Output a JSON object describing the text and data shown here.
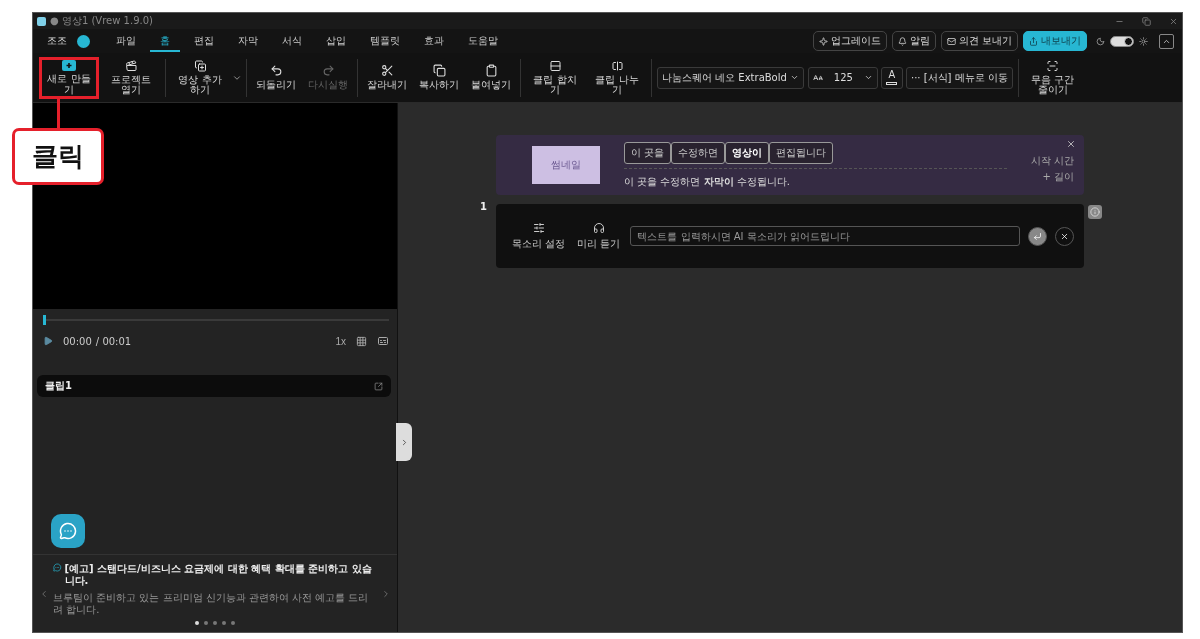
{
  "window": {
    "title": "● 영상1 (Vrew 1.9.0)"
  },
  "menu": {
    "user": "조조",
    "items": [
      {
        "label": "파일",
        "selected": false
      },
      {
        "label": "홈",
        "selected": true
      },
      {
        "label": "편집",
        "selected": false
      },
      {
        "label": "자막",
        "selected": false
      },
      {
        "label": "서식",
        "selected": false
      },
      {
        "label": "삽입",
        "selected": false
      },
      {
        "label": "템플릿",
        "selected": false
      },
      {
        "label": "효과",
        "selected": false
      },
      {
        "label": "도움말",
        "selected": false
      }
    ]
  },
  "top_actions": [
    {
      "label": "업그레이드",
      "kind": "outline"
    },
    {
      "label": "알림",
      "kind": "outline"
    },
    {
      "label": "의견 보내기",
      "kind": "outline"
    },
    {
      "label": "내보내기",
      "kind": "primary"
    }
  ],
  "theme_toggle": {
    "on": true
  },
  "toolbar": {
    "groups": [
      [
        {
          "kind": "button",
          "label": "새로 만들기",
          "disabled": false,
          "highlighted": true
        },
        {
          "kind": "button",
          "label": "프로젝트 열기",
          "disabled": false,
          "highlighted": false
        }
      ],
      [
        {
          "kind": "button",
          "label": "영상 추가하기",
          "disabled": false,
          "highlighted": false
        },
        {
          "kind": "caret"
        }
      ],
      [
        {
          "kind": "button",
          "label": "되돌리기",
          "disabled": false,
          "highlighted": false
        },
        {
          "kind": "button",
          "label": "다시실행",
          "disabled": true,
          "highlighted": false
        }
      ],
      [
        {
          "kind": "button",
          "label": "잘라내기",
          "disabled": false,
          "highlighted": false
        },
        {
          "kind": "button",
          "label": "복사하기",
          "disabled": false,
          "highlighted": false
        },
        {
          "kind": "button",
          "label": "붙여넣기",
          "disabled": false,
          "highlighted": false
        }
      ],
      [
        {
          "kind": "button",
          "label": "클립 합치기",
          "disabled": false,
          "highlighted": false
        },
        {
          "kind": "button",
          "label": "클립 나누기",
          "disabled": false,
          "highlighted": false
        }
      ],
      [
        {
          "kind": "font",
          "value": "나눔스퀘어 네오 ExtraBold"
        },
        {
          "kind": "size",
          "value": "125"
        },
        {
          "kind": "color",
          "value": "A"
        },
        {
          "kind": "link",
          "label": "··· [서식] 메뉴로 이동"
        }
      ],
      [
        {
          "kind": "button",
          "label": "무음 구간 줄이기",
          "disabled": false,
          "highlighted": false
        }
      ]
    ]
  },
  "callout": {
    "label": "클릭"
  },
  "player": {
    "level": 0,
    "current": "00:00",
    "total": "/ 00:01",
    "speed": "1x"
  },
  "clip_list": [
    {
      "label": "클립1"
    }
  ],
  "notice": {
    "title": "[예고] 스탠다드/비즈니스 요금제에 대한 혜택 확대를 준비하고 있습니다.",
    "body": "브루팀이 준비하고 있는 프리미엄 신기능과 관련하여 사전 예고를 드리려 합니다.",
    "pages": [
      {
        "selected": true
      },
      {
        "selected": false
      },
      {
        "selected": false
      },
      {
        "selected": false
      },
      {
        "selected": false
      }
    ]
  },
  "template": {
    "thumbnail": "썸네일",
    "chips": [
      {
        "label": "이 곳을",
        "emphasized": false
      },
      {
        "label": "수정하면",
        "emphasized": false
      },
      {
        "label": "영상이",
        "emphasized": true
      },
      {
        "label": "편집됩니다",
        "emphasized": false
      }
    ],
    "caption": "이 곳을 수정하면 **자막이** 수정됩니다.",
    "start_time": "시작 시간",
    "length": "+ 길이"
  },
  "clip": {
    "number": "1",
    "voice_settings": "목소리 설정",
    "preview": "미리 듣기",
    "placeholder": "텍스트를 입력하시면 AI 목소리가 읽어드립니다"
  }
}
